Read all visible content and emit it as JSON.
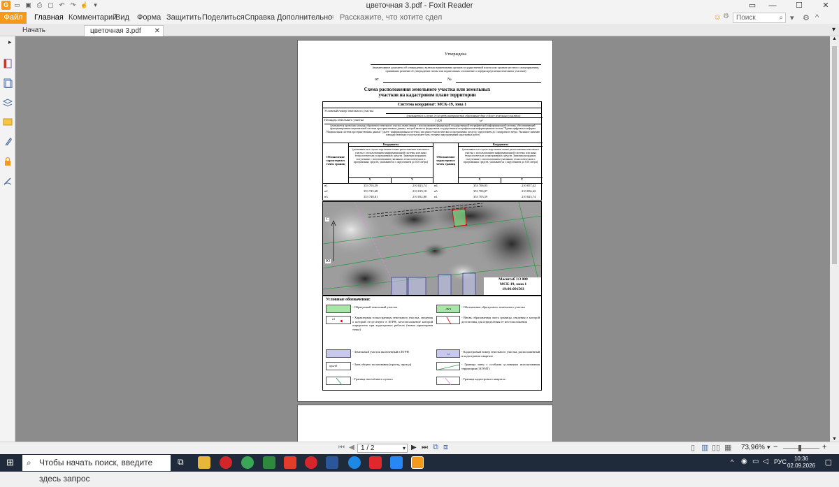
{
  "window": {
    "title": "цветочная 3.pdf - Foxit Reader"
  },
  "menu": {
    "file": "Файл",
    "items": [
      "Главная",
      "Комментарий",
      "Вид",
      "Форма",
      "Защитить",
      "Поделиться",
      "Справка",
      "Дополнительно"
    ],
    "tell_me": "Расскажите, что хотите сдел",
    "search_placeholder": "Поиск"
  },
  "tabs": [
    {
      "label": "Начать"
    },
    {
      "label": "цветочная 3.pdf"
    }
  ],
  "document": {
    "approved": "Утверждена",
    "approval_note": "(наименование документа об утверждении, включая наименования органов государственной власти или органов местного самоуправления, принявших решение об утверждении схемы или подписавших соглашение о перераспределении земельных участков)",
    "from_label": "от",
    "number_label": "№",
    "heading": "Схема расположения земельного участка или земельных участков на кадастровом плане территории",
    "coord_system": "Система координат: МСК-19, зона 1",
    "cond_number_label": "Условный номер земельного участка",
    "cond_number_value": "-",
    "cond_number_note": "(указывается в случае, если предусматривается образование двух и более земельных участков)",
    "area_label": "Площадь земельного участка",
    "area_value": "1 429",
    "area_unit": "м²",
    "area_note": "(указывается проектная площадь образуемого земельного участка, вычисленная с использованием федеральной государственной географической информационной системы, обеспечивающей функционирование национальной системы пространственных данных, которой является федеральная государственная географическая информационная система \"Единая цифровая платформа \"Национальная система пространственных данных\" (далее - информационная система), или иных технологических и программных средств с округлением до 1 квадратного метра. Указанное значение площади земельного участка может быть уточнено при проведении кадастровых работ)",
    "col_point": "Обозначение характерных точек границ",
    "col_coords": "Координаты",
    "col_coords_note": "(указываются в случае подготовки схемы расположения земельного участка с использованием информационной системы или иных технологических и программных средств. Значения координат, полученные с использованием указанных технологических и программных средств, указываются с округлением до 0,01 метра)",
    "x": "X",
    "y": "Y",
    "points_left": [
      {
        "n": "н1",
        "x": "353 703,59",
        "y": "210 023,74"
      },
      {
        "n": "н2",
        "x": "353 745,68",
        "y": "210 019,10"
      },
      {
        "n": "н3",
        "x": "353 748,81",
        "y": "210 052,80"
      }
    ],
    "points_right": [
      {
        "n": "н4",
        "x": "353 706,93",
        "y": "210 057,42"
      },
      {
        "n": "н5",
        "x": "353 706,87",
        "y": "210 056,62"
      },
      {
        "n": "н1",
        "x": "353 703,59",
        "y": "210 023,74"
      }
    ],
    "map": {
      "north": "С",
      "south": "Ю",
      "scale": "Масштаб 1:3 000",
      "system": "МСК-19, зона 1",
      "quarter": "19:06:091503"
    },
    "legend_title": "Условные обозначения:",
    "legend_left": [
      "- Образуемый земельный участок",
      "- Характерная точка границы земельного участка, сведения о которой отсутствуют в ЕГРН, местоположение которой определено при кадастровых работах (новая характерная точка)",
      "- Земельный участок включенный в ЕГРН",
      "- Зона общего пользования (проезд, проход)",
      "- Граница населённого пункта"
    ],
    "legend_right": [
      "- Обозначение образуемого земельного участка",
      "- Вновь образованная часть границы, сведения о которой достаточны для определения ее местоположения",
      "- Кадастровый номер земельного участка, расположенный в кадастровом квартале",
      "- Граница зоны с особыми условиями использования территории (ЗОУИТ)",
      "- Граница кадастрового квартала"
    ],
    "legend_sample_zu": ":ЗУ1",
    "legend_sample_point": "н1",
    "legend_sample_kn": ":ss",
    "legend_sample_road": "проезд"
  },
  "status": {
    "page": "1 / 2",
    "zoom": "73,96%"
  },
  "taskbar": {
    "search": "Чтобы начать поиск, введите здесь запрос",
    "lang": "РУС",
    "time": "10:36",
    "date": "02.09.2026"
  },
  "colors": {
    "file_button": "#f39a1e",
    "taskbar": "#1f2b3a",
    "viewport": "#8c8c8c"
  }
}
